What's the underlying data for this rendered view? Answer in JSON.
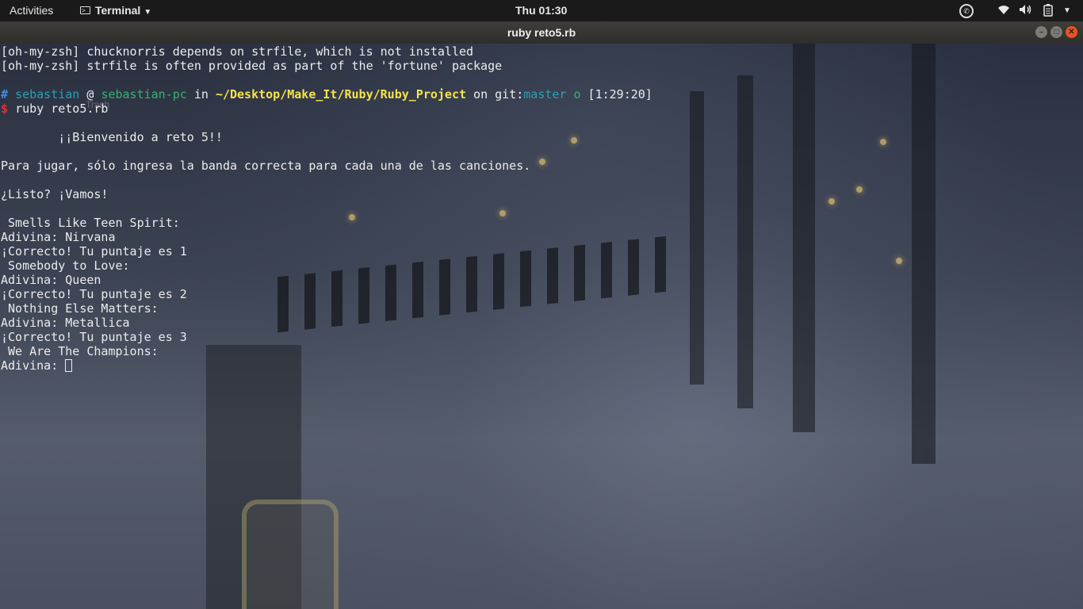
{
  "topbar": {
    "activities": "Activities",
    "app_menu": "Terminal",
    "clock": "Thu 01:30"
  },
  "window": {
    "title": "ruby reto5.rb"
  },
  "desktop": {
    "ghost_label": "Trash"
  },
  "terminal": {
    "lines": {
      "l1": "[oh-my-zsh] chucknorris depends on strfile, which is not installed",
      "l2": "[oh-my-zsh] strfile is often provided as part of the 'fortune' package",
      "prompt": {
        "hash": "#",
        "user": "sebastian",
        "at": "@",
        "host": "sebastian-pc",
        "in": "in",
        "path": "~/Desktop/Make_It/Ruby/Ruby_Project",
        "on": "on",
        "git_label": "git:",
        "branch": "master",
        "status": "o",
        "time": "[1:29:20]",
        "dollar": "$",
        "command": "ruby reto5.rb"
      },
      "welcome": "        ¡¡Bienvenido a reto 5!!",
      "instructions": "Para jugar, sólo ingresa la banda correcta para cada una de las canciones.",
      "ready": "¿Listo? ¡Vamos!",
      "q1": " Smells Like Teen Spirit:",
      "a1": "Adivina: Nirvana",
      "r1": "¡Correcto! Tu puntaje es 1",
      "q2": " Somebody to Love:",
      "a2": "Adivina: Queen",
      "r2": "¡Correcto! Tu puntaje es 2",
      "q3": " Nothing Else Matters:",
      "a3": "Adivina: Metallica",
      "r3": "¡Correcto! Tu puntaje es 3",
      "q4": " We Are The Champions:",
      "a4_prefix": "Adivina: "
    }
  },
  "colors": {
    "prompt_user": "#2aa1b3",
    "prompt_host": "#37b26f",
    "prompt_path": "#f5e34a",
    "prompt_dollar": "#e03333",
    "close_button": "#e95420"
  }
}
